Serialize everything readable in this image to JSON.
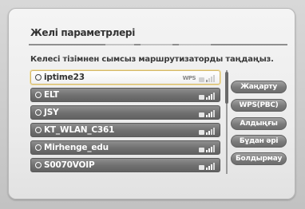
{
  "dialog": {
    "title": "Желі параметрлері",
    "instruction": "Келесі тізімнен сымсыз маршрутизаторды таңдаңыз."
  },
  "networks": [
    {
      "ssid": "iptime23",
      "selected": true,
      "wps": true,
      "icon": "lock-icon",
      "signal": 1
    },
    {
      "ssid": "ELT",
      "selected": false,
      "wps": false,
      "icon": "lock-icon",
      "signal": 2
    },
    {
      "ssid": "JSY",
      "selected": false,
      "wps": false,
      "icon": "lock-icon",
      "signal": 2
    },
    {
      "ssid": "KT_WLAN_C361",
      "selected": false,
      "wps": false,
      "icon": "lock-icon",
      "signal": 1
    },
    {
      "ssid": "Mirhenge_edu",
      "selected": false,
      "wps": false,
      "icon": "lock-icon",
      "signal": 2
    },
    {
      "ssid": "S0070VOIP",
      "selected": false,
      "wps": false,
      "icon": "lock-icon",
      "signal": 2
    }
  ],
  "wps_badge": "WPS",
  "buttons": {
    "refresh": "Жаңарту",
    "wps_pbc": "WPS(PBC)",
    "previous": "Алдыңғы",
    "next": "Бұдан әрі",
    "cancel": "Болдырмау"
  },
  "colors": {
    "selected_border": "#d5b86a",
    "row_bg": "#6f6f6f",
    "button_bg": "#7b7b7b"
  }
}
